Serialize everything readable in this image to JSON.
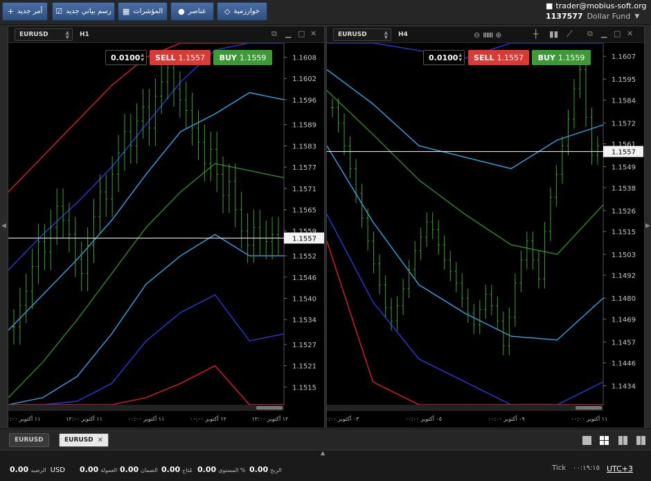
{
  "toolbar": {
    "buttons": [
      {
        "label": "أمر جديد",
        "icon": "plus-icon",
        "glyph": "+"
      },
      {
        "label": "رسم بياني جديد",
        "icon": "chart-icon",
        "glyph": "☑"
      },
      {
        "label": "المؤشرات",
        "icon": "indicators-icon",
        "glyph": "▦"
      },
      {
        "label": "عناصر",
        "icon": "objects-icon",
        "glyph": "●"
      },
      {
        "label": "خوارزمية",
        "icon": "algorithm-icon",
        "glyph": "◇"
      }
    ],
    "account": {
      "user": "trader@mobius-soft.org",
      "balance": "1137577",
      "fund": "Dollar Fund"
    }
  },
  "charts": [
    {
      "symbol": "EURUSD",
      "timeframe": "H1",
      "lot": "0.0100",
      "sell_label": "SELL",
      "sell_price": "1.1557",
      "buy_label": "BUY",
      "buy_price": "1.1559",
      "current_price": "1.1557",
      "price_ticks": [
        "1.1608",
        "1.1602",
        "1.1596",
        "1.1589",
        "1.1583",
        "1.1577",
        "1.1571",
        "1.1565",
        "1.1559",
        "1.1552",
        "1.1546",
        "1.1540",
        "1.1534",
        "1.1527",
        "1.1521",
        "1.1515"
      ],
      "time_ticks": [
        "١١ أكتوبر ٠٠:٠٠",
        "١١ أكتوبر ١٢:٠٠",
        "١١ أكتوبر ٠٠:٠٠",
        "١٢ أكتوبر ٠٠:٠٠",
        "١٢ أكتوبر ١٢:٠٠"
      ],
      "chart_data": {
        "type": "candlestick",
        "ylim": [
          1.151,
          1.1612
        ],
        "price_ticks": [
          1.1608,
          1.1602,
          1.1596,
          1.1589,
          1.1583,
          1.1577,
          1.1571,
          1.1565,
          1.1559,
          1.1552,
          1.1546,
          1.154,
          1.1534,
          1.1527,
          1.1521,
          1.1515
        ],
        "current_price": 1.1557,
        "candles_close": [
          1.1532,
          1.1538,
          1.1542,
          1.1549,
          1.1556,
          1.1553,
          1.156,
          1.1566,
          1.1562,
          1.1558,
          1.1551,
          1.1547,
          1.1555,
          1.1563,
          1.157,
          1.1568,
          1.1575,
          1.1581,
          1.1587,
          1.1583,
          1.159,
          1.1594,
          1.1588,
          1.1597,
          1.1601,
          1.1605,
          1.1599,
          1.1596,
          1.1593,
          1.1588,
          1.1584,
          1.1578,
          1.1582,
          1.1575,
          1.1569,
          1.1573,
          1.1565,
          1.1559,
          1.1555,
          1.156,
          1.1557,
          1.1556,
          1.1558,
          1.1557
        ],
        "series": [
          {
            "name": "band-outer-upper",
            "values": [
              1.157,
              1.158,
              1.159,
              1.16,
              1.1608,
              1.1612,
              1.1612,
              1.1612,
              1.1612
            ]
          },
          {
            "name": "band-upper",
            "values": [
              1.1548,
              1.1558,
              1.1567,
              1.1577,
              1.1589,
              1.1601,
              1.161,
              1.1612,
              1.1612
            ]
          },
          {
            "name": "ma-upper",
            "values": [
              1.1531,
              1.1541,
              1.1551,
              1.1562,
              1.1575,
              1.1587,
              1.1592,
              1.1598,
              1.1596
            ]
          },
          {
            "name": "ma-middle",
            "values": [
              1.1512,
              1.1522,
              1.1534,
              1.1547,
              1.156,
              1.157,
              1.1578,
              1.1576,
              1.1574
            ]
          },
          {
            "name": "ma-lower",
            "values": [
              1.151,
              1.1512,
              1.1518,
              1.153,
              1.1544,
              1.1552,
              1.1558,
              1.1552,
              1.1552
            ]
          },
          {
            "name": "band-lower",
            "values": [
              1.151,
              1.151,
              1.1511,
              1.1516,
              1.1528,
              1.1536,
              1.1541,
              1.1528,
              1.153
            ]
          },
          {
            "name": "band-outer-lower",
            "values": [
              1.151,
              1.151,
              1.151,
              1.151,
              1.1512,
              1.1516,
              1.1521,
              1.151,
              1.151
            ]
          }
        ]
      }
    },
    {
      "symbol": "EURUSD",
      "timeframe": "H4",
      "lot": "0.0100",
      "sell_label": "SELL",
      "sell_price": "1.1557",
      "buy_label": "BUY",
      "buy_price": "1.1559",
      "current_price": "1.1557",
      "price_ticks": [
        "1.1607",
        "1.1595",
        "1.1584",
        "1.1572",
        "1.1561",
        "1.1549",
        "1.1538",
        "1.1526",
        "1.1515",
        "1.1503",
        "1.1492",
        "1.1480",
        "1.1469",
        "1.1457",
        "1.1446",
        "1.1434"
      ],
      "time_ticks": [
        "٠٣ أكتوبر ٠٠:٠٠",
        "٠٥ أكتوبر ٠٠:٠٠",
        "٠٩ أكتوبر ٠٠:٠٠",
        "١١ أكتوبر ٠٠:٠٠"
      ],
      "chart_data": {
        "type": "candlestick",
        "ylim": [
          1.1424,
          1.1614
        ],
        "price_ticks": [
          1.1607,
          1.1595,
          1.1584,
          1.1572,
          1.1561,
          1.1549,
          1.1538,
          1.1526,
          1.1515,
          1.1503,
          1.1492,
          1.148,
          1.1469,
          1.1457,
          1.1446,
          1.1434
        ],
        "current_price": 1.1557,
        "candles_close": [
          1.158,
          1.1572,
          1.156,
          1.1548,
          1.1535,
          1.1522,
          1.151,
          1.1498,
          1.1487,
          1.1475,
          1.1468,
          1.1476,
          1.1485,
          1.1495,
          1.1505,
          1.1512,
          1.152,
          1.1516,
          1.1508,
          1.15,
          1.1494,
          1.1488,
          1.148,
          1.1472,
          1.1466,
          1.1474,
          1.1482,
          1.1476,
          1.1468,
          1.1455,
          1.147,
          1.1488,
          1.15,
          1.151,
          1.15,
          1.149,
          1.1515,
          1.1533,
          1.1545,
          1.156,
          1.1574,
          1.159,
          1.16,
          1.1575,
          1.1555,
          1.156
        ],
        "series": [
          {
            "name": "band-upper",
            "values": [
              1.1614,
              1.1614,
              1.161,
              1.1606,
              1.1614,
              1.1614,
              1.1614
            ]
          },
          {
            "name": "ma-upper",
            "values": [
              1.16,
              1.1582,
              1.156,
              1.1554,
              1.1548,
              1.1563,
              1.1571
            ]
          },
          {
            "name": "ma-middle",
            "values": [
              1.1589,
              1.1566,
              1.1542,
              1.1524,
              1.1508,
              1.1503,
              1.1529
            ]
          },
          {
            "name": "ma-lower",
            "values": [
              1.156,
              1.152,
              1.1487,
              1.1472,
              1.146,
              1.1458,
              1.148
            ]
          },
          {
            "name": "band-lower",
            "values": [
              1.1524,
              1.1478,
              1.1448,
              1.1436,
              1.1424,
              1.1424,
              1.1436
            ]
          },
          {
            "name": "band-outer-lower",
            "values": [
              1.151,
              1.1436,
              1.1424,
              1.1424,
              1.1424,
              1.1424,
              1.1424
            ]
          }
        ]
      }
    }
  ],
  "tabs": [
    {
      "label": "EURUSD",
      "active": false
    },
    {
      "label": "EURUSD",
      "active": true,
      "close": "✕"
    }
  ],
  "status": {
    "balance_value": "0.00",
    "balance_label": "الرصيد",
    "currency": "USD",
    "commission_value": "0.00",
    "commission_label": "العمولة",
    "margin_value": "0.00",
    "margin_label": "الضمان",
    "free_value": "0.00",
    "free_label": "مُتاح",
    "level_value": "0.00",
    "level_label": "المستوى %",
    "profit_value": "0.00",
    "profit_label": "الربح",
    "tick_label": "Tick",
    "time": "٠٠:١٩:١٥",
    "timezone": "UTC+3"
  },
  "colors": {
    "candle": "#3fa035",
    "ma_outer": "#e02020",
    "ma_blue": "#1f3fd8",
    "ma_cyan": "#2fa8e8",
    "ma_green": "#2f8a2a",
    "sell": "#d93a34",
    "buy": "#3e9a37"
  }
}
